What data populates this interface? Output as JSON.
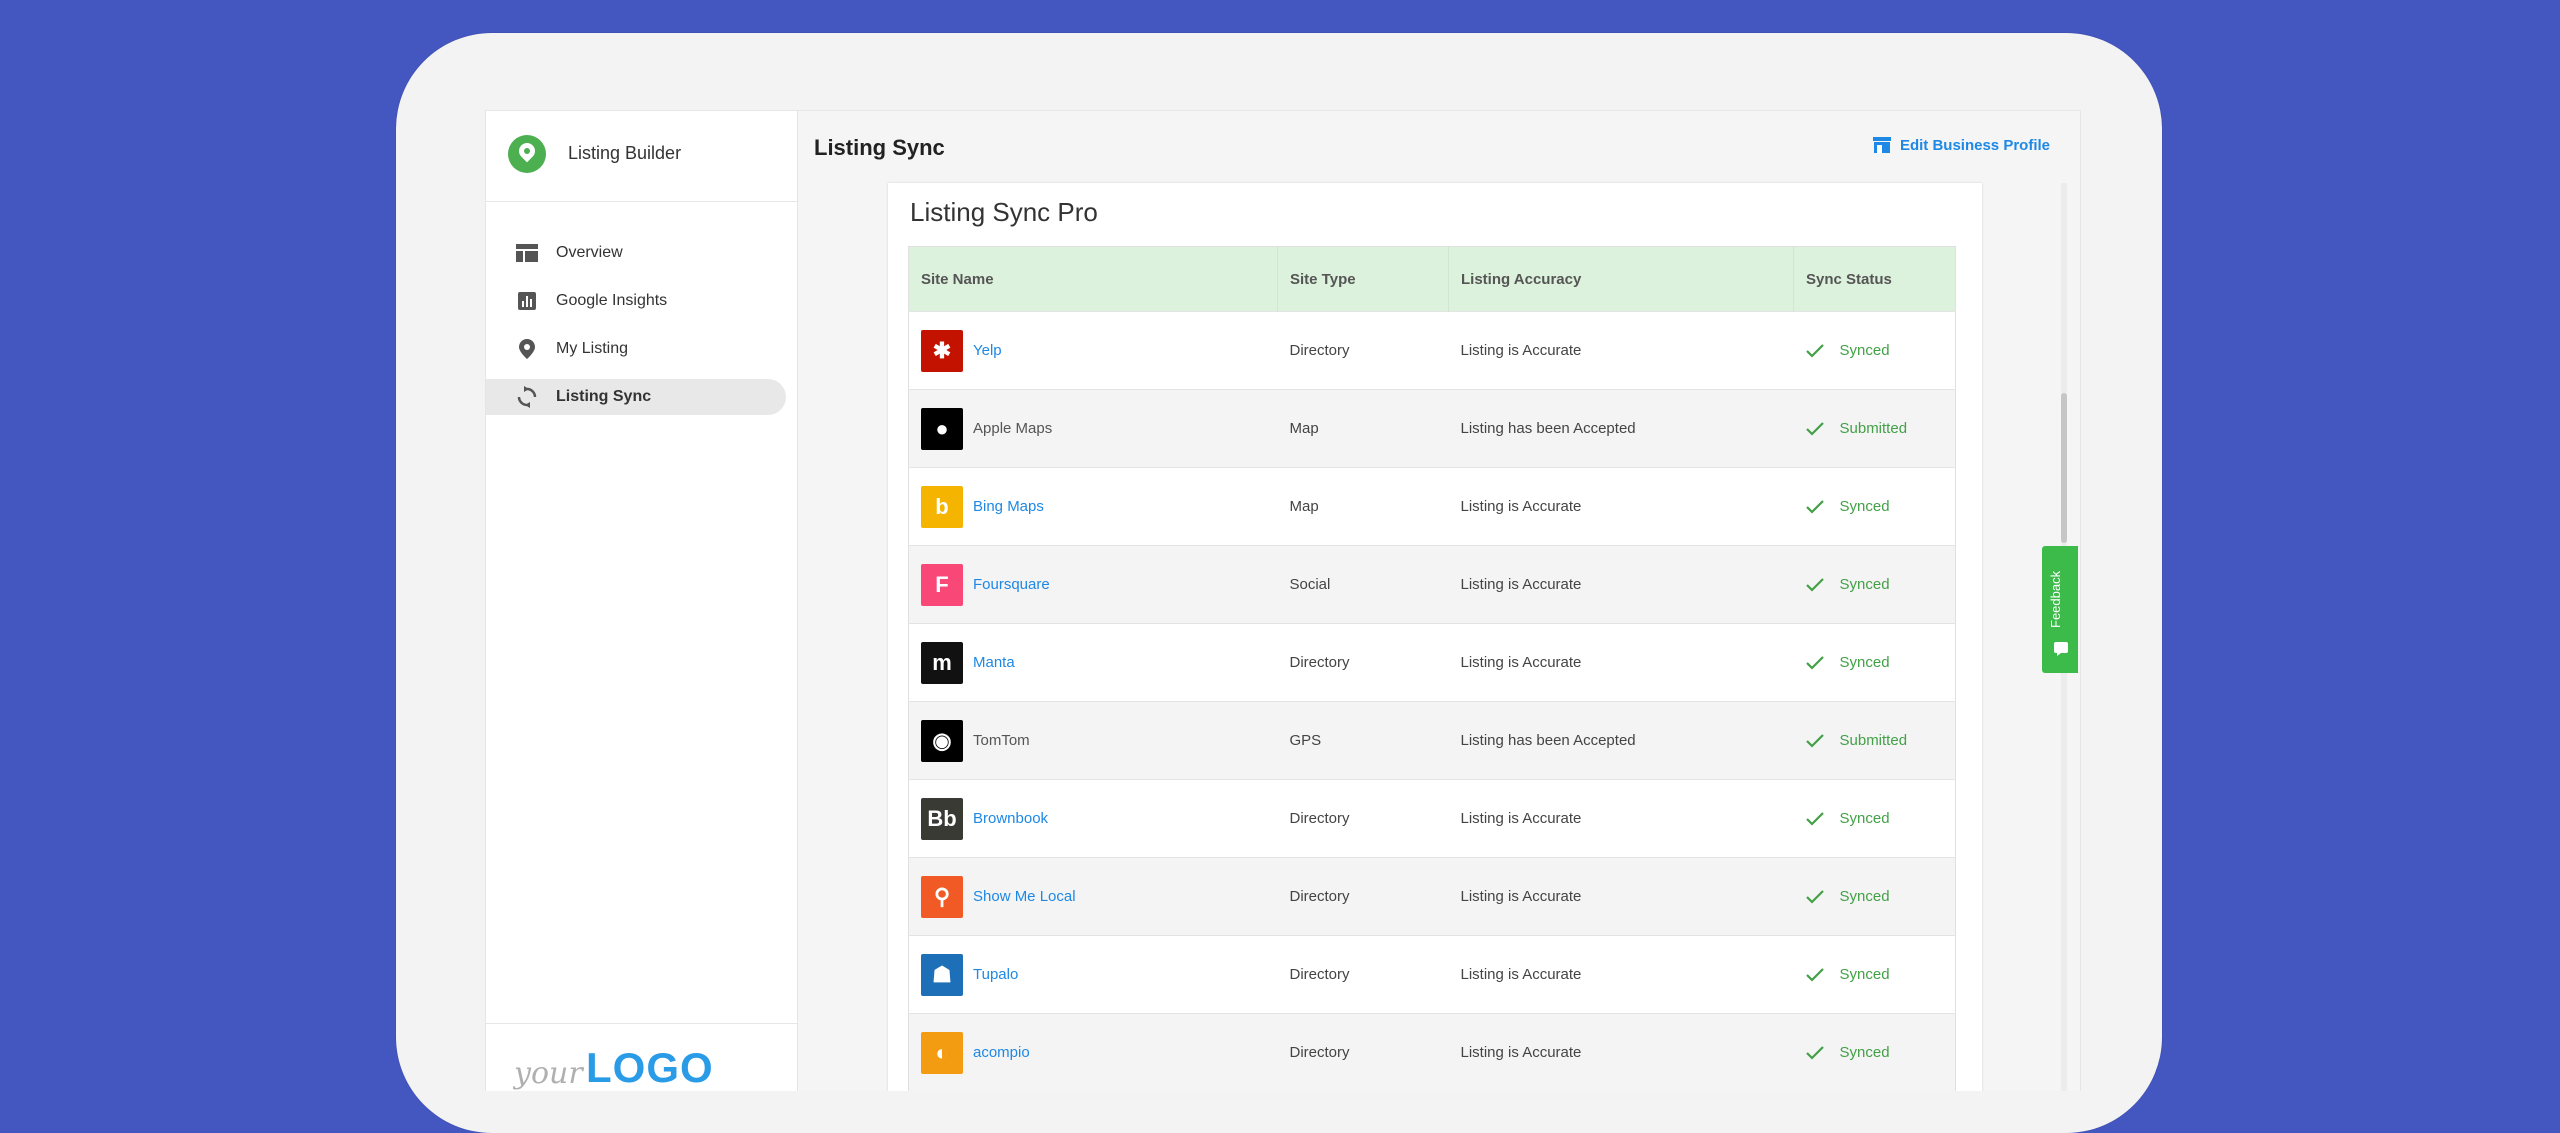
{
  "app": {
    "name": "Listing Builder"
  },
  "sidebar": {
    "items": [
      {
        "label": "Overview",
        "icon": "layout-icon",
        "active": false
      },
      {
        "label": "Google Insights",
        "icon": "bar-chart-icon",
        "active": false
      },
      {
        "label": "My Listing",
        "icon": "location-pin-icon",
        "active": false
      },
      {
        "label": "Listing Sync",
        "icon": "sync-icon",
        "active": true
      }
    ],
    "footer_logo": {
      "prefix": "your",
      "main": "LOGO"
    }
  },
  "header": {
    "title": "Listing Sync",
    "edit_profile_label": "Edit Business Profile"
  },
  "card": {
    "title": "Listing Sync Pro",
    "columns": [
      "Site Name",
      "Site Type",
      "Listing Accuracy",
      "Sync Status"
    ],
    "rows": [
      {
        "site": "Yelp",
        "type": "Directory",
        "accuracy": "Listing is Accurate",
        "status": "Synced",
        "link": true,
        "icon_bg": "#c41200",
        "glyph": "✱"
      },
      {
        "site": "Apple Maps",
        "type": "Map",
        "accuracy": "Listing has been Accepted",
        "status": "Submitted",
        "link": false,
        "icon_bg": "#000000",
        "glyph": "●"
      },
      {
        "site": "Bing Maps",
        "type": "Map",
        "accuracy": "Listing is Accurate",
        "status": "Synced",
        "link": true,
        "icon_bg": "#f4b400",
        "glyph": "b"
      },
      {
        "site": "Foursquare",
        "type": "Social",
        "accuracy": "Listing is Accurate",
        "status": "Synced",
        "link": true,
        "icon_bg": "#f94877",
        "glyph": "F"
      },
      {
        "site": "Manta",
        "type": "Directory",
        "accuracy": "Listing is Accurate",
        "status": "Synced",
        "link": true,
        "icon_bg": "#111111",
        "glyph": "m"
      },
      {
        "site": "TomTom",
        "type": "GPS",
        "accuracy": "Listing has been Accepted",
        "status": "Submitted",
        "link": false,
        "icon_bg": "#000000",
        "glyph": "◉"
      },
      {
        "site": "Brownbook",
        "type": "Directory",
        "accuracy": "Listing is Accurate",
        "status": "Synced",
        "link": true,
        "icon_bg": "#3a3a35",
        "glyph": "Bb"
      },
      {
        "site": "Show Me Local",
        "type": "Directory",
        "accuracy": "Listing is Accurate",
        "status": "Synced",
        "link": true,
        "icon_bg": "#f15a24",
        "glyph": "⚲"
      },
      {
        "site": "Tupalo",
        "type": "Directory",
        "accuracy": "Listing is Accurate",
        "status": "Synced",
        "link": true,
        "icon_bg": "#1d6fb8",
        "glyph": "☗"
      },
      {
        "site": "acompio",
        "type": "Directory",
        "accuracy": "Listing is Accurate",
        "status": "Synced",
        "link": true,
        "icon_bg": "#f39c12",
        "glyph": "◐"
      }
    ]
  },
  "feedback": {
    "label": "Feedback"
  },
  "colors": {
    "background": "#4457c1",
    "accent_blue": "#1e88e5",
    "success_green": "#43a047",
    "header_row": "#ddf2dd"
  }
}
